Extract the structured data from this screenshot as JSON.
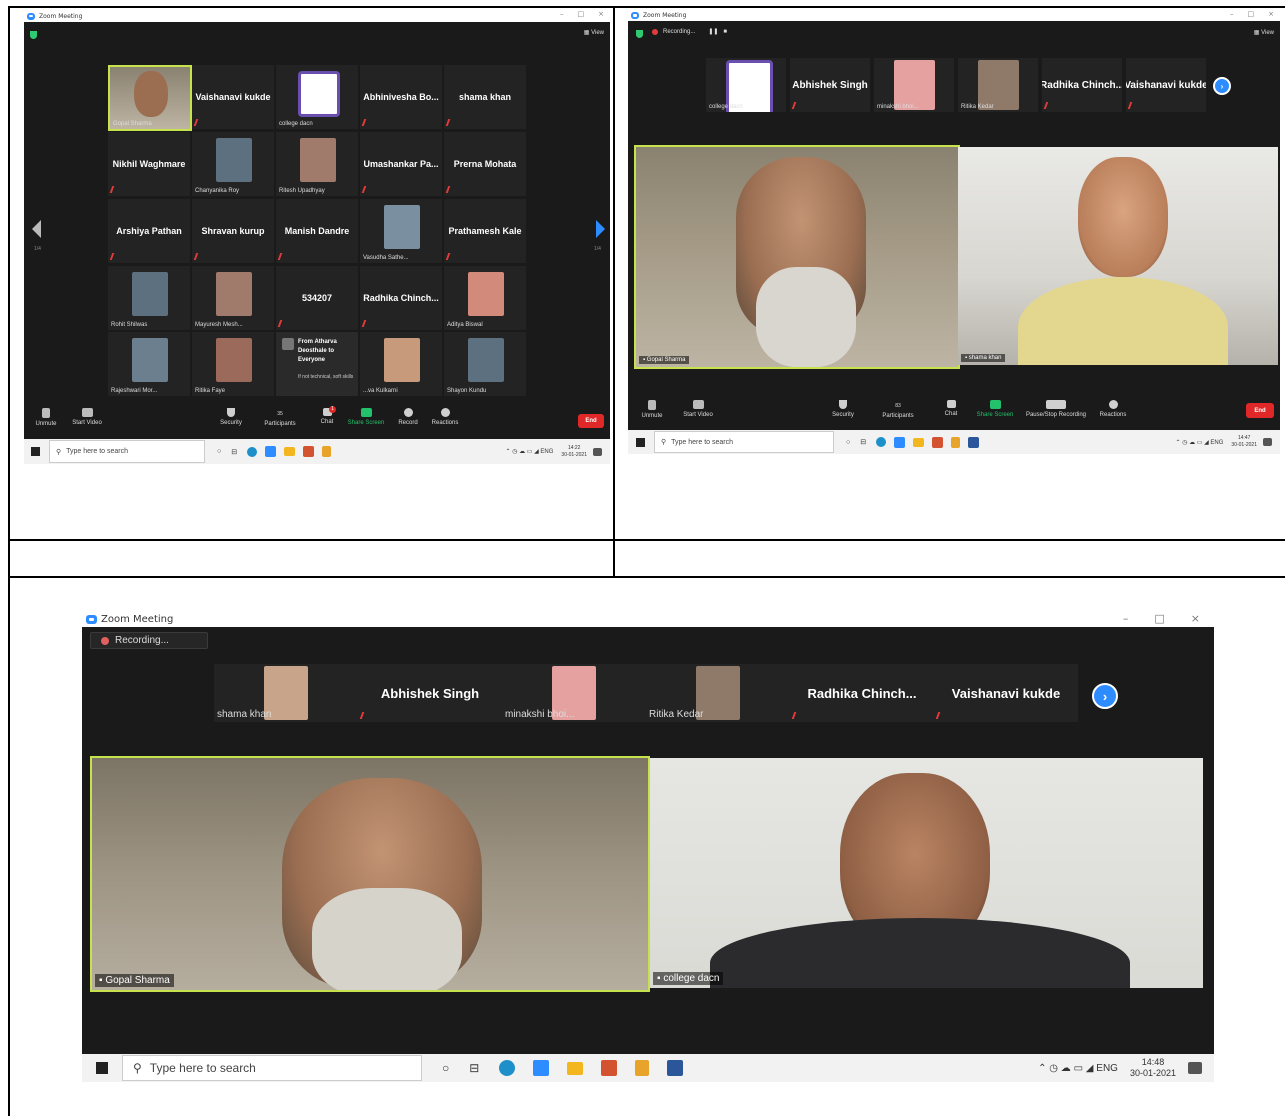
{
  "window_title": "Zoom Meeting",
  "panel1": {
    "view_label": "View",
    "page_left": "1/4",
    "page_right": "1/4",
    "tiles": [
      {
        "name": "Gopal Sharma",
        "kind": "video"
      },
      {
        "name": "Vaishanavi kukde",
        "kind": "name"
      },
      {
        "name": "college dacn",
        "kind": "logo"
      },
      {
        "name": "Abhinivesha Bo...",
        "kind": "name"
      },
      {
        "name": "shama khan",
        "kind": "name"
      },
      {
        "name": "Nikhil Waghmare",
        "kind": "name"
      },
      {
        "name": "Chanyanika Roy",
        "kind": "photo"
      },
      {
        "name": "Ritesh Upadhyay",
        "kind": "photo"
      },
      {
        "name": "Umashankar Pa...",
        "kind": "name"
      },
      {
        "name": "Prerna Mohata",
        "kind": "name"
      },
      {
        "name": "Arshiya Pathan",
        "kind": "name"
      },
      {
        "name": "Shravan kurup",
        "kind": "name"
      },
      {
        "name": "Manish Dandre",
        "kind": "name"
      },
      {
        "name": "Vasudha Sathe...",
        "kind": "photo"
      },
      {
        "name": "Prathamesh Kale",
        "kind": "name"
      },
      {
        "name": "Rohit Shilwas",
        "kind": "photo"
      },
      {
        "name": "Mayuresh Mesh...",
        "kind": "photo"
      },
      {
        "name": "534207",
        "kind": "name"
      },
      {
        "name": "Radhika Chinch...",
        "kind": "name"
      },
      {
        "name": "Aditya Biswal",
        "kind": "photo"
      },
      {
        "name": "Rajeshwari Mor...",
        "kind": "photo"
      },
      {
        "name": "Ritika Faye",
        "kind": "photo"
      },
      {
        "name": "",
        "kind": "chat"
      },
      {
        "name": "...va Kulkarni",
        "kind": "photo"
      },
      {
        "name": "Shayon Kundu",
        "kind": "photo"
      }
    ],
    "chat_popup": {
      "from": "From Atharva Deosthale to Everyone",
      "message": "If not technical, soft skills"
    },
    "toolbar": {
      "unmute": "Unmute",
      "start_video": "Start Video",
      "security": "Security",
      "participants": "Participants",
      "participants_count": "35",
      "chat": "Chat",
      "chat_badge": "1",
      "share_screen": "Share Screen",
      "record": "Record",
      "reactions": "Reactions",
      "end": "End"
    },
    "taskbar": {
      "search": "Type here to search",
      "lang": "ENG",
      "time": "14:22",
      "date": "30-01-2021"
    }
  },
  "panel2": {
    "view_label": "View",
    "recording": "Recording...",
    "strip": [
      {
        "name": "college dacn",
        "kind": "logo"
      },
      {
        "name": "Abhishek Singh",
        "kind": "name"
      },
      {
        "name": "minakshi bhoi...",
        "kind": "photo"
      },
      {
        "name": "Ritika Kedar",
        "kind": "photo"
      },
      {
        "name": "Radhika Chinch...",
        "kind": "name"
      },
      {
        "name": "Vaishanavi kukde",
        "kind": "name"
      }
    ],
    "video_left": "Gopal Sharma",
    "video_right": "shama khan",
    "toolbar": {
      "unmute": "Unmute",
      "start_video": "Start Video",
      "security": "Security",
      "participants": "Participants",
      "participants_count": "83",
      "chat": "Chat",
      "share_screen": "Share Screen",
      "pause_record": "Pause/Stop Recording",
      "reactions": "Reactions",
      "end": "End"
    },
    "taskbar": {
      "search": "Type here to search",
      "lang": "ENG",
      "time": "14:47",
      "date": "30-01-2021"
    }
  },
  "panel3": {
    "recording": "Recording...",
    "strip": [
      {
        "name": "shama khan",
        "kind": "photo"
      },
      {
        "name": "Abhishek Singh",
        "kind": "name"
      },
      {
        "name": "minakshi bhoi...",
        "kind": "photo"
      },
      {
        "name": "Ritika Kedar",
        "kind": "photo"
      },
      {
        "name": "Radhika Chinch...",
        "kind": "name"
      },
      {
        "name": "Vaishanavi kukde",
        "kind": "name"
      }
    ],
    "video_left": "Gopal Sharma",
    "video_right": "college dacn",
    "taskbar": {
      "search": "Type here to search",
      "lang": "ENG",
      "time": "14:48",
      "date": "30-01-2021"
    }
  }
}
